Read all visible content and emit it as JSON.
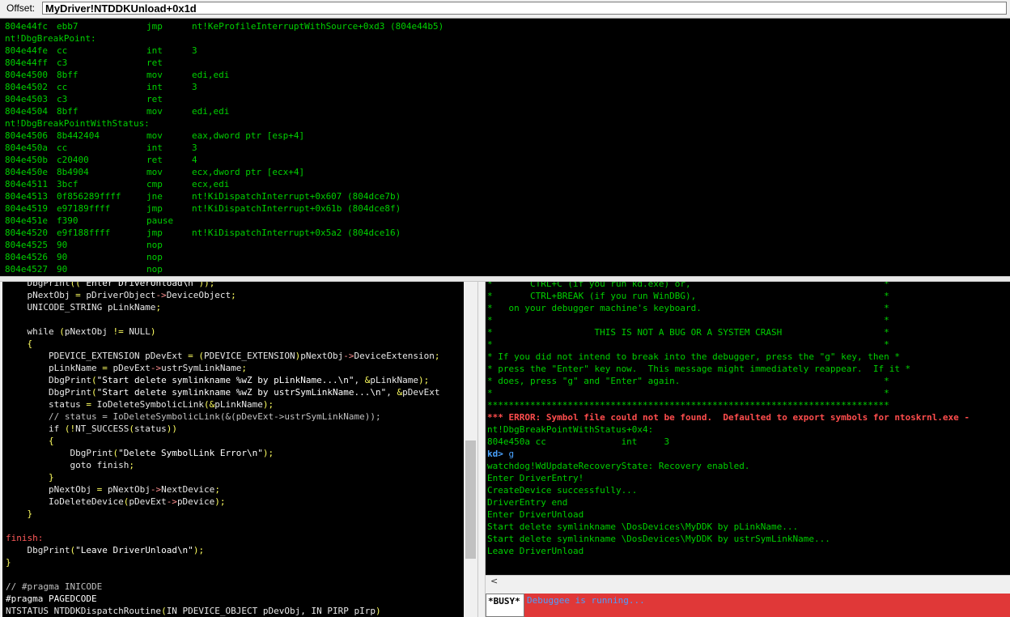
{
  "offset": {
    "label": "Offset:",
    "value": "MyDriver!NTDDKUnload+0x1d"
  },
  "disassembly": [
    {
      "addr": "804e44fc",
      "bytes": "ebb7",
      "mn": "jmp",
      "op": "nt!KeProfileInterruptWithSource+0xd3 (804e44b5)"
    },
    {
      "label": "nt!DbgBreakPoint:"
    },
    {
      "addr": "804e44fe",
      "bytes": "cc",
      "mn": "int",
      "op": "3"
    },
    {
      "addr": "804e44ff",
      "bytes": "c3",
      "mn": "ret",
      "op": ""
    },
    {
      "addr": "804e4500",
      "bytes": "8bff",
      "mn": "mov",
      "op": "edi,edi"
    },
    {
      "addr": "804e4502",
      "bytes": "cc",
      "mn": "int",
      "op": "3"
    },
    {
      "addr": "804e4503",
      "bytes": "c3",
      "mn": "ret",
      "op": ""
    },
    {
      "addr": "804e4504",
      "bytes": "8bff",
      "mn": "mov",
      "op": "edi,edi"
    },
    {
      "label": "nt!DbgBreakPointWithStatus:"
    },
    {
      "addr": "804e4506",
      "bytes": "8b442404",
      "mn": "mov",
      "op": "eax,dword ptr [esp+4]"
    },
    {
      "addr": "804e450a",
      "bytes": "cc",
      "mn": "int",
      "op": "3"
    },
    {
      "addr": "804e450b",
      "bytes": "c20400",
      "mn": "ret",
      "op": "4"
    },
    {
      "addr": "804e450e",
      "bytes": "8b4904",
      "mn": "mov",
      "op": "ecx,dword ptr [ecx+4]"
    },
    {
      "addr": "804e4511",
      "bytes": "3bcf",
      "mn": "cmp",
      "op": "ecx,edi"
    },
    {
      "addr": "804e4513",
      "bytes": "0f856289ffff",
      "mn": "jne",
      "op": "nt!KiDispatchInterrupt+0x607 (804dce7b)"
    },
    {
      "addr": "804e4519",
      "bytes": "e97189ffff",
      "mn": "jmp",
      "op": "nt!KiDispatchInterrupt+0x61b (804dce8f)"
    },
    {
      "addr": "804e451e",
      "bytes": "f390",
      "mn": "pause",
      "op": ""
    },
    {
      "addr": "804e4520",
      "bytes": "e9f188ffff",
      "mn": "jmp",
      "op": "nt!KiDispatchInterrupt+0x5a2 (804dce16)"
    },
    {
      "addr": "804e4525",
      "bytes": "90",
      "mn": "nop",
      "op": ""
    },
    {
      "addr": "804e4526",
      "bytes": "90",
      "mn": "nop",
      "op": ""
    },
    {
      "addr": "804e4527",
      "bytes": "90",
      "mn": "nop",
      "op": ""
    }
  ],
  "source": [
    "    DbgPrint((\"Enter DriverUnload\\n\"));",
    "    pNextObj = pDriverObject->DeviceObject;",
    "    UNICODE_STRING pLinkName;",
    "",
    "    while (pNextObj != NULL)",
    "    {",
    "        PDEVICE_EXTENSION pDevExt = (PDEVICE_EXTENSION)pNextObj->DeviceExtension;",
    "        pLinkName = pDevExt->ustrSymLinkName;",
    "        DbgPrint(\"Start delete symlinkname %wZ by pLinkName...\\n\", &pLinkName);",
    "        DbgPrint(\"Start delete symlinkname %wZ by ustrSymLinkName...\\n\", &pDevExt",
    "        status = IoDeleteSymbolicLink(&pLinkName);",
    "        // status = IoDeleteSymbolicLink(&(pDevExt->ustrSymLinkName));",
    "        if (!NT_SUCCESS(status))",
    "        {",
    "            DbgPrint(\"Delete SymbolLink Error\\n\");",
    "            goto finish;",
    "        }",
    "        pNextObj = pNextObj->NextDevice;",
    "        IoDeleteDevice(pDevExt->pDevice);",
    "    }",
    "",
    "finish:",
    "    DbgPrint(\"Leave DriverUnload\\n\");",
    "}",
    "",
    "// #pragma INICODE",
    "#pragma PAGEDCODE",
    "NTSTATUS NTDDKDispatchRoutine(IN PDEVICE_OBJECT pDevObj, IN PIRP pIrp)"
  ],
  "command": [
    {
      "t": "*       CTRL+C (if you run kd.exe) or,                                    *",
      "c": "g"
    },
    {
      "t": "*       CTRL+BREAK (if you run WinDBG),                                   *",
      "c": "g"
    },
    {
      "t": "*   on your debugger machine's keyboard.                                  *",
      "c": "g"
    },
    {
      "t": "*                                                                         *",
      "c": "g"
    },
    {
      "t": "*                   THIS IS NOT A BUG OR A SYSTEM CRASH                   *",
      "c": "g"
    },
    {
      "t": "*                                                                         *",
      "c": "g"
    },
    {
      "t": "* If you did not intend to break into the debugger, press the \"g\" key, then *",
      "c": "g"
    },
    {
      "t": "* press the \"Enter\" key now.  This message might immediately reappear.  If it *",
      "c": "g"
    },
    {
      "t": "* does, press \"g\" and \"Enter\" again.                                      *",
      "c": "g"
    },
    {
      "t": "*                                                                         *",
      "c": "g"
    },
    {
      "t": "***************************************************************************",
      "c": "g"
    },
    {
      "t": "*** ERROR: Symbol file could not be found.  Defaulted to export symbols for ntoskrnl.exe -",
      "c": "err"
    },
    {
      "t": "nt!DbgBreakPointWithStatus+0x4:",
      "c": "g"
    },
    {
      "t": "804e450a cc              int     3",
      "c": "g"
    },
    {
      "prompt": "kd>",
      "cmd": " g"
    },
    {
      "t": "watchdog!WdUpdateRecoveryState: Recovery enabled.",
      "c": "g"
    },
    {
      "t": "Enter DriverEntry!",
      "c": "g"
    },
    {
      "t": "CreateDevice successfully...",
      "c": "g"
    },
    {
      "t": "DriverEntry end",
      "c": "g"
    },
    {
      "t": "Enter DriverUnload",
      "c": "g"
    },
    {
      "t": "Start delete symlinkname \\DosDevices\\MyDDK by pLinkName...",
      "c": "g"
    },
    {
      "t": "Start delete symlinkname \\DosDevices\\MyDDK by ustrSymLinkName...",
      "c": "g"
    },
    {
      "t": "Leave DriverUnload",
      "c": "g"
    }
  ],
  "scroll": {
    "left_arrow": "<"
  },
  "status": {
    "busy_label": "*BUSY*",
    "message": "Debuggee is running..."
  },
  "colors": {
    "disasm_text": "#00d000",
    "error_text": "#ff4d4d",
    "prompt": "#4aa3ff",
    "busy_bg": "#e03838"
  }
}
